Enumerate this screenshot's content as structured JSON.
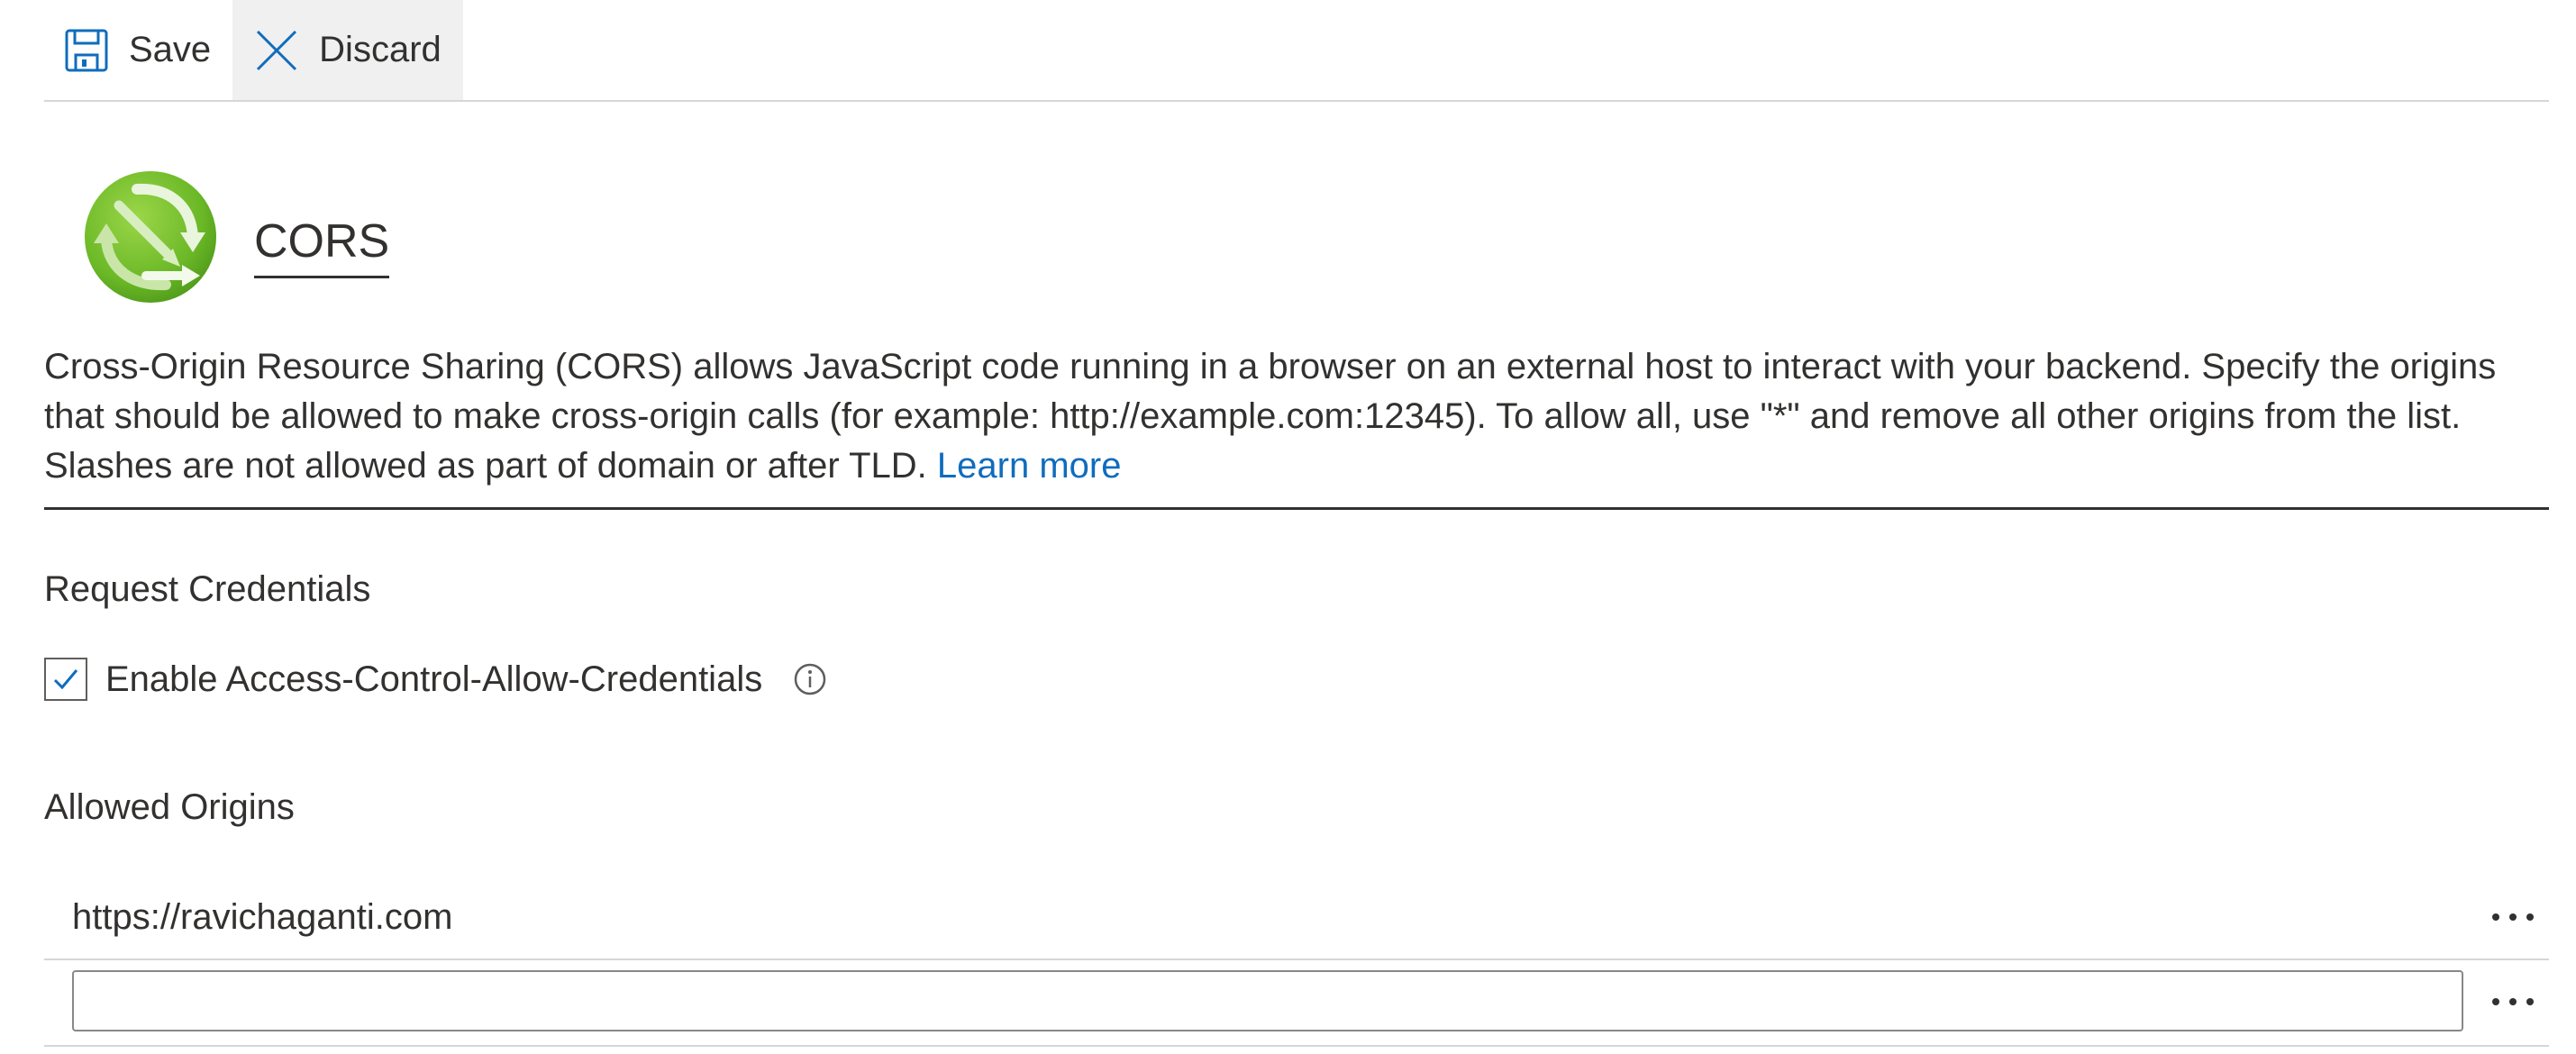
{
  "toolbar": {
    "save_label": "Save",
    "discard_label": "Discard"
  },
  "header": {
    "title": "CORS",
    "logo_icon": "cors-globe-arrows-icon"
  },
  "description": {
    "text": "Cross-Origin Resource Sharing (CORS) allows JavaScript code running in a browser on an external host to interact with your backend. Specify the origins that should be allowed to make cross-origin calls (for example: http://example.com:12345). To allow all, use \"*\" and remove all other origins from the list. Slashes are not allowed as part of domain or after TLD.",
    "learn_more": "Learn more"
  },
  "request_credentials": {
    "heading": "Request Credentials",
    "checkbox_label": "Enable Access-Control-Allow-Credentials",
    "checked": true
  },
  "allowed_origins": {
    "heading": "Allowed Origins",
    "items": [
      {
        "value": "https://ravichaganti.com"
      }
    ],
    "new_entry": {
      "value": "",
      "placeholder": ""
    }
  },
  "colors": {
    "accent": "#0f6cbd",
    "text": "#323130",
    "logo_green": "#6bb827",
    "divider": "#d6d6d6"
  }
}
